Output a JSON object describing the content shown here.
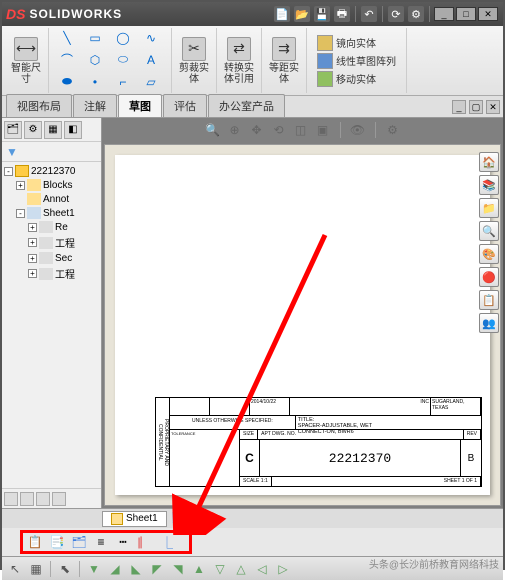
{
  "titlebar": {
    "brand": "SOLIDWORKS"
  },
  "ribbon": {
    "smart_dim": "智能尺寸",
    "trim": "剪裁实体",
    "convert": "转换实体引用",
    "offset": "等距实体",
    "mirror": "镜向实体",
    "pattern": "线性草图阵列",
    "move": "移动实体"
  },
  "tabs": {
    "t1": "视图布局",
    "t2": "注解",
    "t3": "草图",
    "t4": "评估",
    "t5": "办公室产品"
  },
  "tree": {
    "root": "22212370",
    "blocks": "Blocks",
    "annot": "Annot",
    "sheet": "Sheet1",
    "re": "Re",
    "eng1": "工程",
    "sec": "Sec",
    "eng2": "工程"
  },
  "titleblock": {
    "confidential": "PROPRIETARY AND CONFIDENTIAL",
    "date": "2014/10/22",
    "company_loc": "SUGARLAND, TEXAS",
    "company": "INC",
    "unless": "UNLESS OTHERWISE SPECIFIED:",
    "tolerance": "TOLERANCE",
    "title_label": "TITLE:",
    "title1": "SPACER-ADJUSTABLE, WET",
    "title2": "CONNECT-ON, BWR6",
    "size_label": "SIZE",
    "size": "C",
    "dwg_label": "APT DWG. NO.",
    "dwg_no": "22212370",
    "rev_label": "REV",
    "rev": "B",
    "scale": "SCALE 1:1",
    "sheet": "SHEET 1 OF 1"
  },
  "sheettab": {
    "label": "Sheet1"
  },
  "watermark": "头条@长沙前桥教育网络科技"
}
